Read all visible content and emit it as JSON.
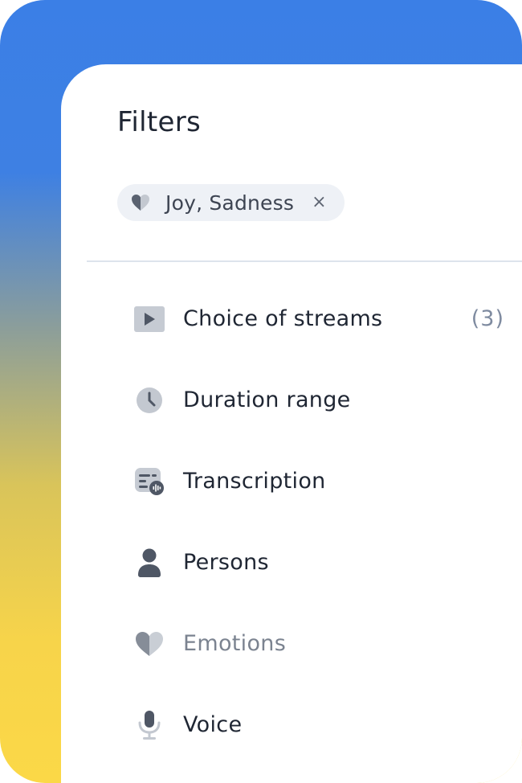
{
  "panel": {
    "title": "Filters"
  },
  "active_filter_chip": {
    "icon": "heart-icon",
    "label": "Joy, Sadness",
    "remove_label": "×"
  },
  "filters": [
    {
      "icon": "play-icon",
      "label": "Choice of streams",
      "count": "(3)"
    },
    {
      "icon": "clock-icon",
      "label": "Duration range",
      "count": ""
    },
    {
      "icon": "transcription-icon",
      "label": "Transcription",
      "count": ""
    },
    {
      "icon": "person-icon",
      "label": "Persons",
      "count": ""
    },
    {
      "icon": "heart-icon",
      "label": "Emotions",
      "count": ""
    },
    {
      "icon": "microphone-icon",
      "label": "Voice",
      "count": ""
    }
  ],
  "colors": {
    "gradient_top": "#3b7fe6",
    "gradient_bottom": "#fbd847",
    "text_primary": "#1f2633",
    "text_muted": "#7b8390",
    "chip_bg": "#eef1f6",
    "icon_gray": "#a7adb6",
    "icon_dark": "#505866"
  }
}
